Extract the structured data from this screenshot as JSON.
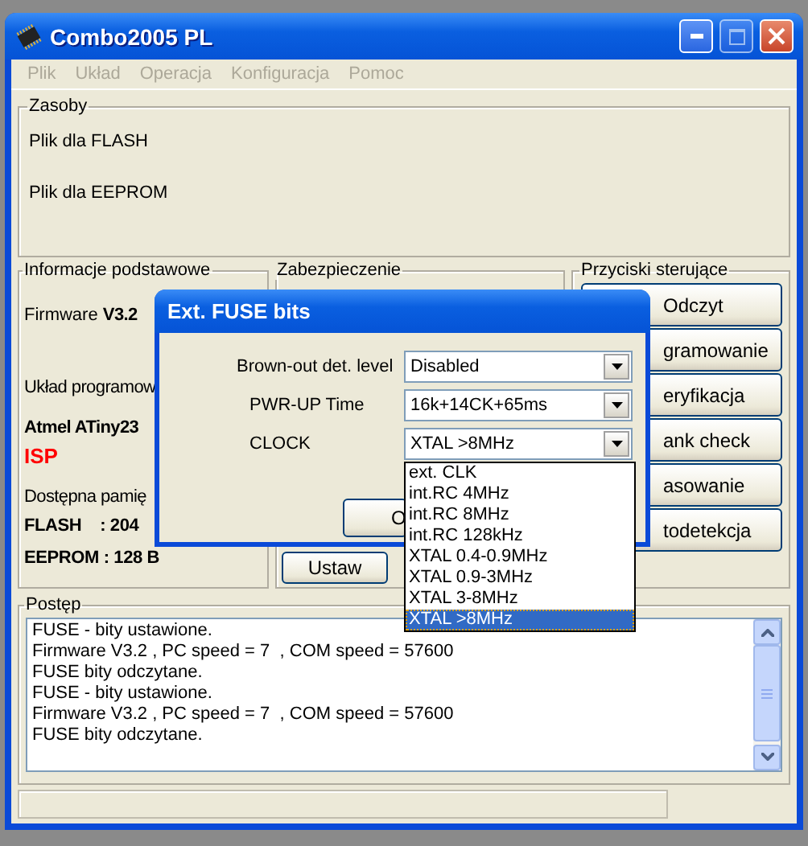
{
  "window": {
    "title": "Combo2005 PL"
  },
  "menu": [
    {
      "label": "Plik",
      "disabled": true
    },
    {
      "label": "Układ",
      "disabled": true
    },
    {
      "label": "Operacja",
      "disabled": true
    },
    {
      "label": "Konfiguracja",
      "disabled": true
    },
    {
      "label": "Pomoc",
      "disabled": true
    }
  ],
  "resources": {
    "title": "Zasoby",
    "items": [
      "Plik dla FLASH",
      "Plik dla EEPROM"
    ]
  },
  "info": {
    "title": "Informacje podstawowe",
    "firmware_label": "Firmware",
    "firmware_version": "V3.2",
    "chip_label": "Układ programow",
    "chip": "Atmel ATiny23",
    "mode": "ISP",
    "memory_label": "Dostępna pamię",
    "memory": [
      "FLASH    : 204",
      "EEPROM : 128 B"
    ]
  },
  "protection": {
    "title": "Zabezpieczenie",
    "button": "Ustaw"
  },
  "controls": {
    "title": "Przyciski sterujące",
    "buttons": [
      "Odczyt",
      "gramowanie",
      "eryfikacja",
      "ank check",
      "asowanie",
      "todetekcja"
    ]
  },
  "progress": {
    "title": "Postęp",
    "log": [
      "FUSE - bity ustawione.",
      "Firmware V3.2 , PC speed = 7  , COM speed = 57600",
      "FUSE bity odczytane.",
      "FUSE - bity ustawione.",
      "Firmware V3.2 , PC speed = 7  , COM speed = 57600",
      "FUSE bity odczytane."
    ]
  },
  "dialog": {
    "title": "Ext. FUSE bits",
    "fields": [
      {
        "label": "Brown-out det. level",
        "value": "Disabled"
      },
      {
        "label": "PWR-UP Time",
        "value": "16k+14CK+65ms"
      },
      {
        "label": "CLOCK",
        "value": "XTAL >8MHz"
      }
    ],
    "ok_button": "O",
    "dropdown": [
      {
        "label": "ext. CLK",
        "selected": false
      },
      {
        "label": "int.RC 4MHz",
        "selected": false
      },
      {
        "label": "int.RC 8MHz",
        "selected": false
      },
      {
        "label": "int.RC 128kHz",
        "selected": false
      },
      {
        "label": "XTAL 0.4-0.9MHz",
        "selected": false
      },
      {
        "label": "XTAL 0.9-3MHz",
        "selected": false
      },
      {
        "label": "XTAL 3-8MHz",
        "selected": false
      },
      {
        "label": "XTAL >8MHz",
        "selected": true
      }
    ]
  }
}
